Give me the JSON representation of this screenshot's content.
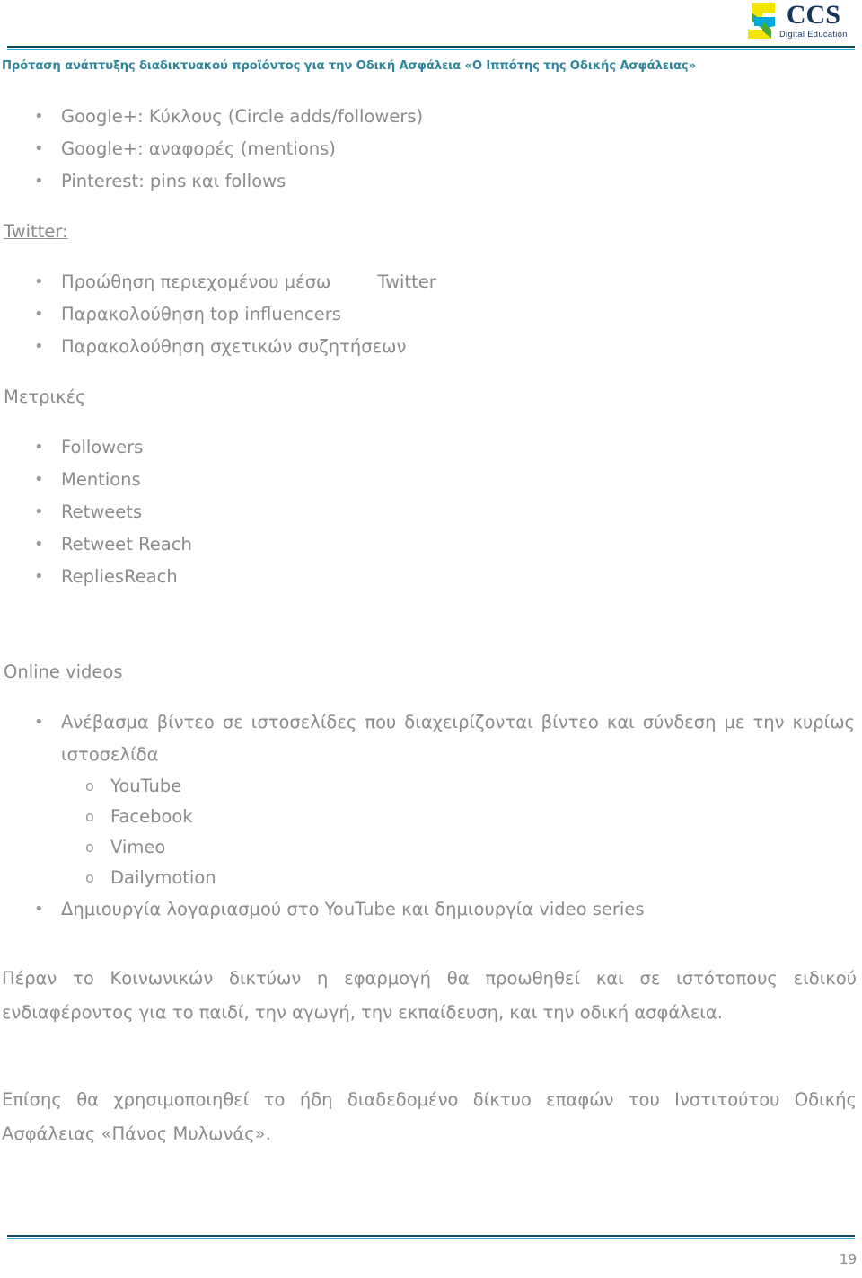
{
  "header": {
    "title": "Πρόταση ανάπτυξης διαδικτυακού προϊόντος για την Οδική Ασφάλεια «Ο Ιππότης της Οδικής Ασφάλειας»",
    "title_color": "#31859c",
    "rule_dark_color": "#17465f",
    "rule_light_color": "#35a8dc",
    "logo": {
      "name": "CCS",
      "tagline": "Digital Education",
      "text_color": "#15355e",
      "mark_colors": {
        "yellow": "#f2e500",
        "green": "#4aa83a",
        "blue": "#00a6de"
      }
    }
  },
  "content": {
    "top_bullets": [
      "Google+: Κύκλους (Circle adds/followers)",
      "Google+: αναφορές (mentions)",
      "Pinterest: pins και follows"
    ],
    "twitter_section": {
      "heading": "Twitter:",
      "bullets_first_part": "Προώθηση περιεχομένου μέσω",
      "bullets_first_tail": "Twitter",
      "bullets": [
        "Παρακολούθηση top influencers",
        "Παρακολούθηση σχετικών συζητήσεων"
      ]
    },
    "metrics_section": {
      "heading": "Μετρικές",
      "bullets": [
        "Followers",
        "Mentions",
        "Retweets",
        "Retweet Reach",
        "RepliesReach"
      ]
    },
    "videos_section": {
      "heading": "Online videos",
      "bullet_upload_line1": "Ανέβασμα βίντεο σε ιστοσελίδες που διαχειρίζονται βίντεο και σύνδεση με την κυρίως",
      "bullet_upload_line2": "ιστοσελίδα",
      "sub_bullets": [
        "YouTube",
        "Facebook",
        "Vimeo",
        "Dailymotion"
      ],
      "bullet_account": "Δημιουργία λογαριασμού στο YouTube και δημιουργία video series"
    },
    "paragraphs": [
      "Πέραν το Κοινωνικών δικτύων η εφαρμογή θα προωθηθεί και σε ιστότοπους ειδικού ενδιαφέροντος για το παιδί, την αγωγή, την εκπαίδευση, και την οδική ασφάλεια.",
      "Επίσης θα χρησιμοποιηθεί το ήδη διαδεδομένο δίκτυο επαφών του Ινστιτούτου Οδικής Ασφάλειας «Πάνος Μυλωνάς»."
    ]
  },
  "footer": {
    "page_number": "19"
  }
}
